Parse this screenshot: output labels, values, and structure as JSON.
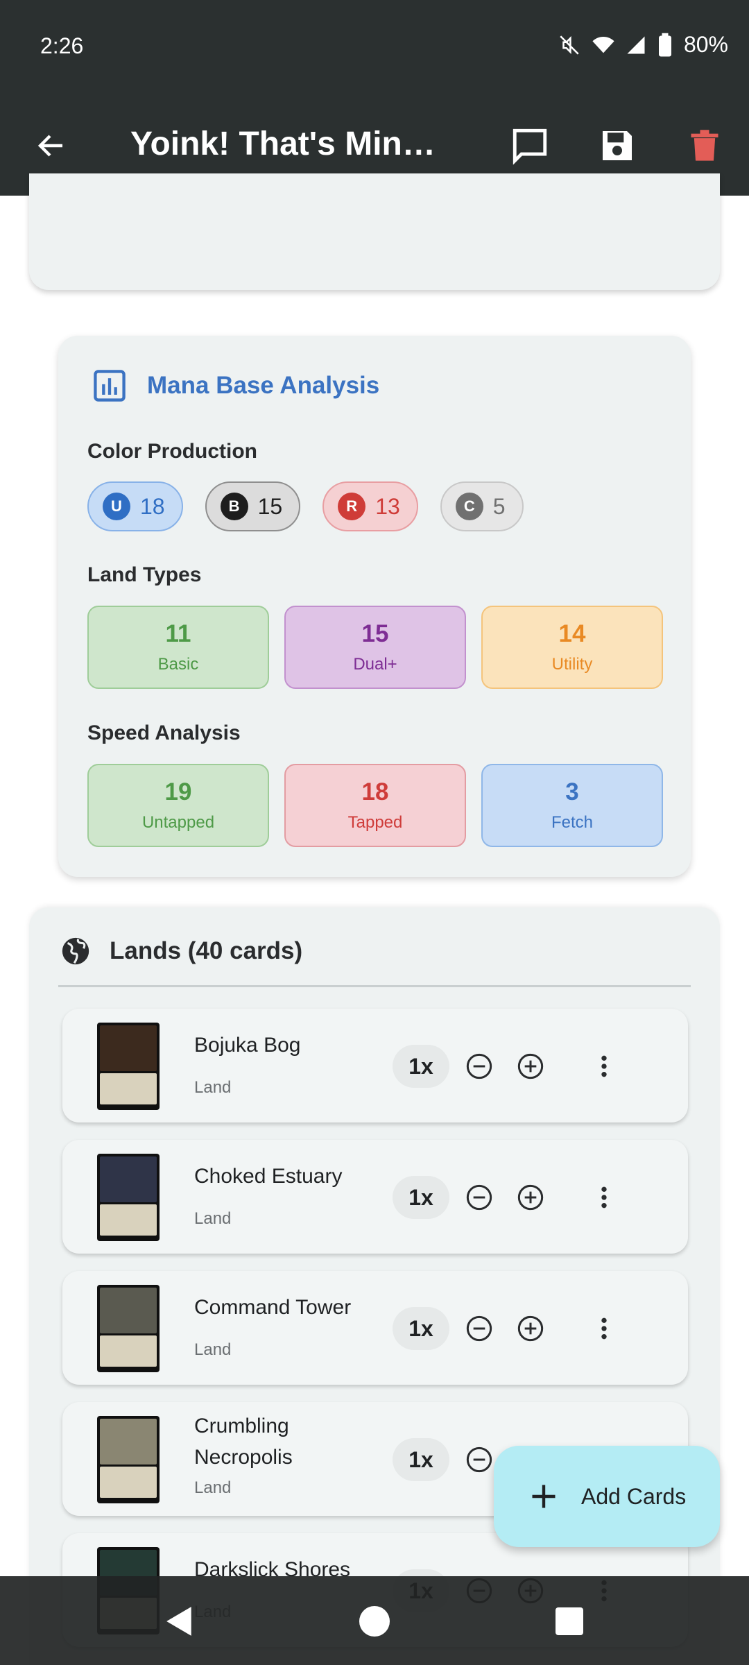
{
  "status_bar": {
    "time": "2:26",
    "battery": "80%",
    "icons": [
      "mute-icon",
      "wifi-icon",
      "signal-icon",
      "battery-icon"
    ]
  },
  "app_bar": {
    "title": "Yoink! That's Mine ...",
    "icons": [
      "back-arrow-icon",
      "comment-icon",
      "save-icon",
      "delete-icon"
    ],
    "delete_color": "#e35d57"
  },
  "mana_analysis": {
    "title": "Mana Base Analysis",
    "accent_color": "#3b73c2",
    "color_production": {
      "label": "Color Production",
      "items": [
        {
          "symbol": "U",
          "count": "18",
          "bg": "#c6dcf6",
          "border": "#88b2e8",
          "dot": "#2f6ec4",
          "text": "#2f6ec4"
        },
        {
          "symbol": "B",
          "count": "15",
          "bg": "#dcdcdc",
          "border": "#8f8f8f",
          "dot": "#1e1e1e",
          "text": "#1e1e1e"
        },
        {
          "symbol": "R",
          "count": "13",
          "bg": "#f5d0d2",
          "border": "#e89ea2",
          "dot": "#cf3c38",
          "text": "#cf3c38"
        },
        {
          "symbol": "C",
          "count": "5",
          "bg": "#e6e6e6",
          "border": "#c8c8c8",
          "dot": "#707070",
          "text": "#707070"
        }
      ]
    },
    "land_types": {
      "label": "Land Types",
      "items": [
        {
          "value": "11",
          "label": "Basic",
          "bg": "#cfe6cc",
          "border": "#9fcd99",
          "color": "#4e9a47"
        },
        {
          "value": "15",
          "label": "Dual+",
          "bg": "#dfc3e6",
          "border": "#c291ce",
          "color": "#7e2d94"
        },
        {
          "value": "14",
          "label": "Utility",
          "bg": "#fbe3bb",
          "border": "#f4c47c",
          "color": "#e98a24"
        }
      ]
    },
    "speed_analysis": {
      "label": "Speed Analysis",
      "items": [
        {
          "value": "19",
          "label": "Untapped",
          "bg": "#cfe6cc",
          "border": "#9fcd99",
          "color": "#4e9a47"
        },
        {
          "value": "18",
          "label": "Tapped",
          "bg": "#f5d0d4",
          "border": "#e39ca2",
          "color": "#cf3c3a"
        },
        {
          "value": "3",
          "label": "Fetch",
          "bg": "#c7dcf6",
          "border": "#8fb7e8",
          "color": "#3b73c2"
        }
      ]
    }
  },
  "lands": {
    "title": "Lands (40 cards)",
    "cards": [
      {
        "name": "Bojuka Bog",
        "type": "Land",
        "qty": "1x",
        "art": "#3c2a1e"
      },
      {
        "name": "Choked Estuary",
        "type": "Land",
        "qty": "1x",
        "art": "#2f3448"
      },
      {
        "name": "Command Tower",
        "type": "Land",
        "qty": "1x",
        "art": "#5a5a50"
      },
      {
        "name": "Crumbling Necropolis",
        "type": "Land",
        "qty": "1x",
        "art": "#8a8672"
      },
      {
        "name": "Darkslick Shores",
        "type": "Land",
        "qty": "1x",
        "art": "#243a34"
      }
    ]
  },
  "fab": {
    "label": "Add Cards"
  },
  "nav_bar": {
    "icons": [
      "back-triangle-icon",
      "home-circle-icon",
      "recents-square-icon"
    ]
  }
}
